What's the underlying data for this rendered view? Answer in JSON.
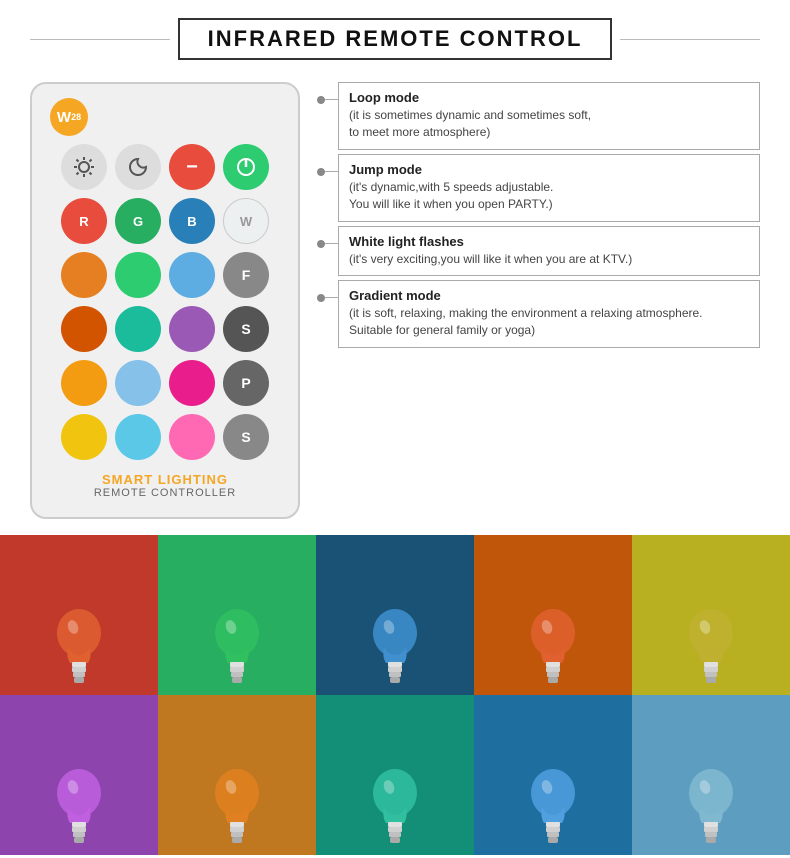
{
  "header": {
    "title": "INFRARED REMOTE CONTROL"
  },
  "remote": {
    "badge": "W28",
    "label_main": "SMART LIGHTING",
    "label_sub": "REMOTE CONTROLLER",
    "rows": [
      [
        "up-icon",
        "down-icon",
        "minus",
        "circle-o"
      ],
      [
        "R",
        "G",
        "B",
        "W"
      ],
      [
        "orange",
        "limegreen",
        "lightblue",
        "F"
      ],
      [
        "darkorange",
        "cyan",
        "violet",
        "S"
      ],
      [
        "yellow-orange",
        "lightcyan",
        "pink",
        "P"
      ],
      [
        "yellow",
        "skyblue",
        "hotpink",
        "S2"
      ]
    ]
  },
  "features": [
    {
      "title": "Loop mode",
      "desc": "(it is sometimes dynamic and sometimes soft,\nto meet more atmosphere)"
    },
    {
      "title": "Jump mode",
      "desc": "(it's dynamic,with 5 speeds adjustable.\nYou will like it when you open PARTY.)"
    },
    {
      "title": "White light flashes",
      "desc": "(it's very exciting,you will like it when you are at KTV.)"
    },
    {
      "title": "Gradient mode",
      "desc": "(it is soft, relaxing, making the environment a relaxing atmosphere.\nSuitable for general family or yoga)"
    }
  ],
  "color_rows": [
    [
      "#c0392b",
      "#27ae60",
      "#1a5276",
      "#c0560a",
      "#b8b020"
    ],
    [
      "#8e44ad",
      "#c07820",
      "#148f77",
      "#1e6fa0",
      "#5d9ec0"
    ]
  ]
}
